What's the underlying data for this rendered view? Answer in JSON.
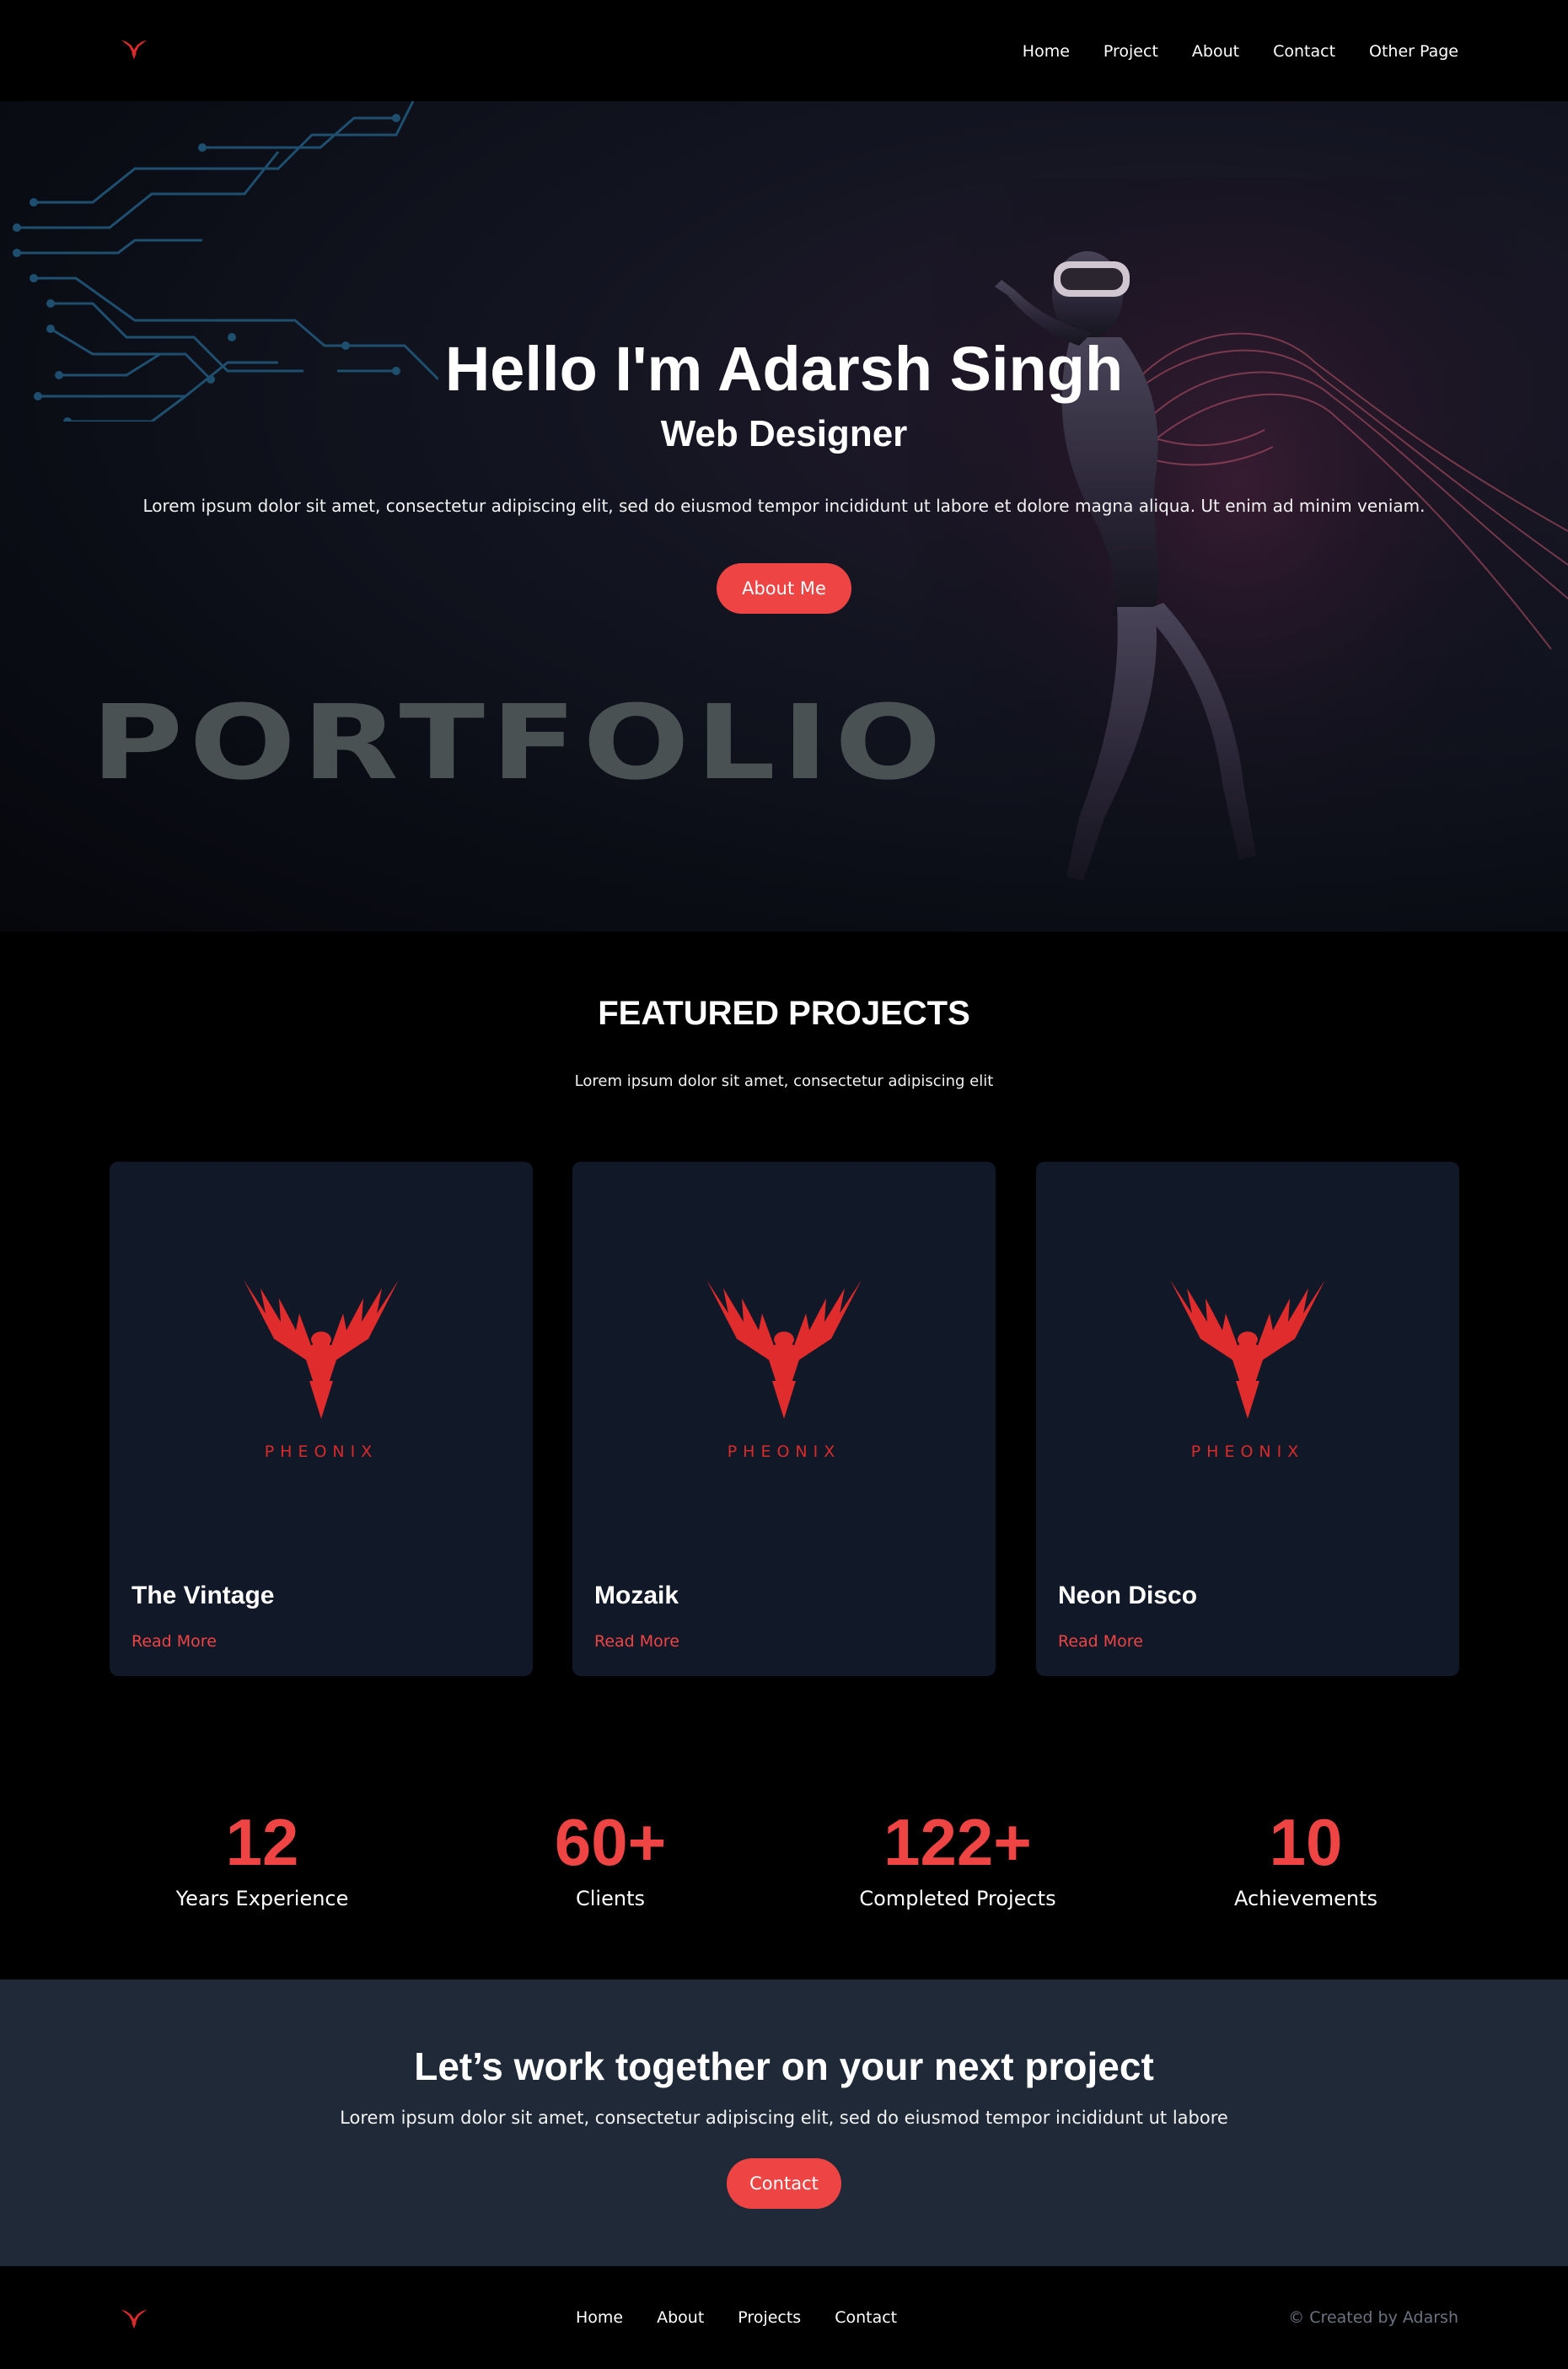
{
  "nav": {
    "links": [
      "Home",
      "Project",
      "About",
      "Contact",
      "Other Page"
    ]
  },
  "hero": {
    "title": "Hello I'm Adarsh Singh",
    "subtitle": "Web Designer",
    "text": "Lorem ipsum dolor sit amet, consectetur adipiscing elit, sed do eiusmod tempor incididunt ut labore et dolore magna aliqua. Ut enim ad minim veniam.",
    "button": "About Me",
    "big_word": "PORTFOLIO"
  },
  "featured": {
    "title": "FEATURED PROJECTS",
    "subtitle": "Lorem ipsum dolor sit amet, consectetur adipiscing elit",
    "cards": [
      {
        "brand": "PHEONIX",
        "name": "The Vintage",
        "link": "Read More"
      },
      {
        "brand": "PHEONIX",
        "name": "Mozaik",
        "link": "Read More"
      },
      {
        "brand": "PHEONIX",
        "name": "Neon Disco",
        "link": "Read More"
      }
    ]
  },
  "stats": [
    {
      "value": "12",
      "label": "Years Experience"
    },
    {
      "value": "60+",
      "label": "Clients"
    },
    {
      "value": "122+",
      "label": "Completed Projects"
    },
    {
      "value": "10",
      "label": "Achievements"
    }
  ],
  "cta": {
    "title": "Let’s work together on your next project",
    "text": "Lorem ipsum dolor sit amet, consectetur adipiscing elit, sed do eiusmod tempor incididunt ut labore",
    "button": "Contact"
  },
  "footer": {
    "links": [
      "Home",
      "About",
      "Projects",
      "Contact"
    ],
    "copyright": "© Created by Adarsh"
  },
  "colors": {
    "accent": "#ef4444",
    "card_bg": "#111827",
    "cta_bg": "#1f2937",
    "page_bg": "#000000"
  },
  "icons": [
    "phoenix-logo-icon",
    "circuit-lines-graphic",
    "vr-figure-graphic"
  ]
}
